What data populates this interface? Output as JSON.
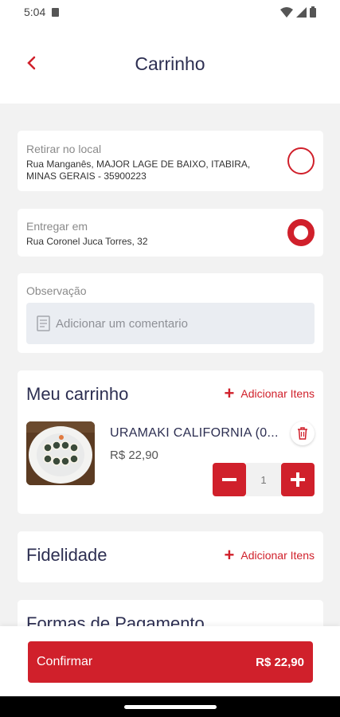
{
  "status_bar": {
    "time": "5:04"
  },
  "header": {
    "title": "Carrinho"
  },
  "pickup": {
    "label": "Retirar no local",
    "address": "Rua Manganês, MAJOR LAGE DE BAIXO, ITABIRA, MINAS GERAIS - 35900223",
    "selected": false
  },
  "delivery": {
    "label": "Entregar em",
    "address": "Rua Coronel Juca Torres, 32",
    "selected": true
  },
  "observation": {
    "label": "Observação",
    "placeholder": "Adicionar um comentario"
  },
  "cart": {
    "title": "Meu carrinho",
    "add_label": "Adicionar Itens",
    "items": [
      {
        "name": "URAMAKI CALIFORNIA (0...",
        "price": "R$ 22,90",
        "quantity": "1"
      }
    ]
  },
  "loyalty": {
    "title": "Fidelidade",
    "add_label": "Adicionar Itens"
  },
  "payment": {
    "title": "Formas de Pagamento"
  },
  "footer": {
    "confirm_label": "Confirmar",
    "total": "R$ 22,90"
  },
  "colors": {
    "accent": "#d0202b",
    "title_text": "#2d2f52",
    "background": "#f2f2f2"
  },
  "icons": [
    "sd-card-icon",
    "wifi-icon",
    "signal-icon",
    "battery-icon",
    "back-arrow-icon",
    "radio-icon",
    "document-icon",
    "plus-icon",
    "trash-icon",
    "minus-icon"
  ]
}
